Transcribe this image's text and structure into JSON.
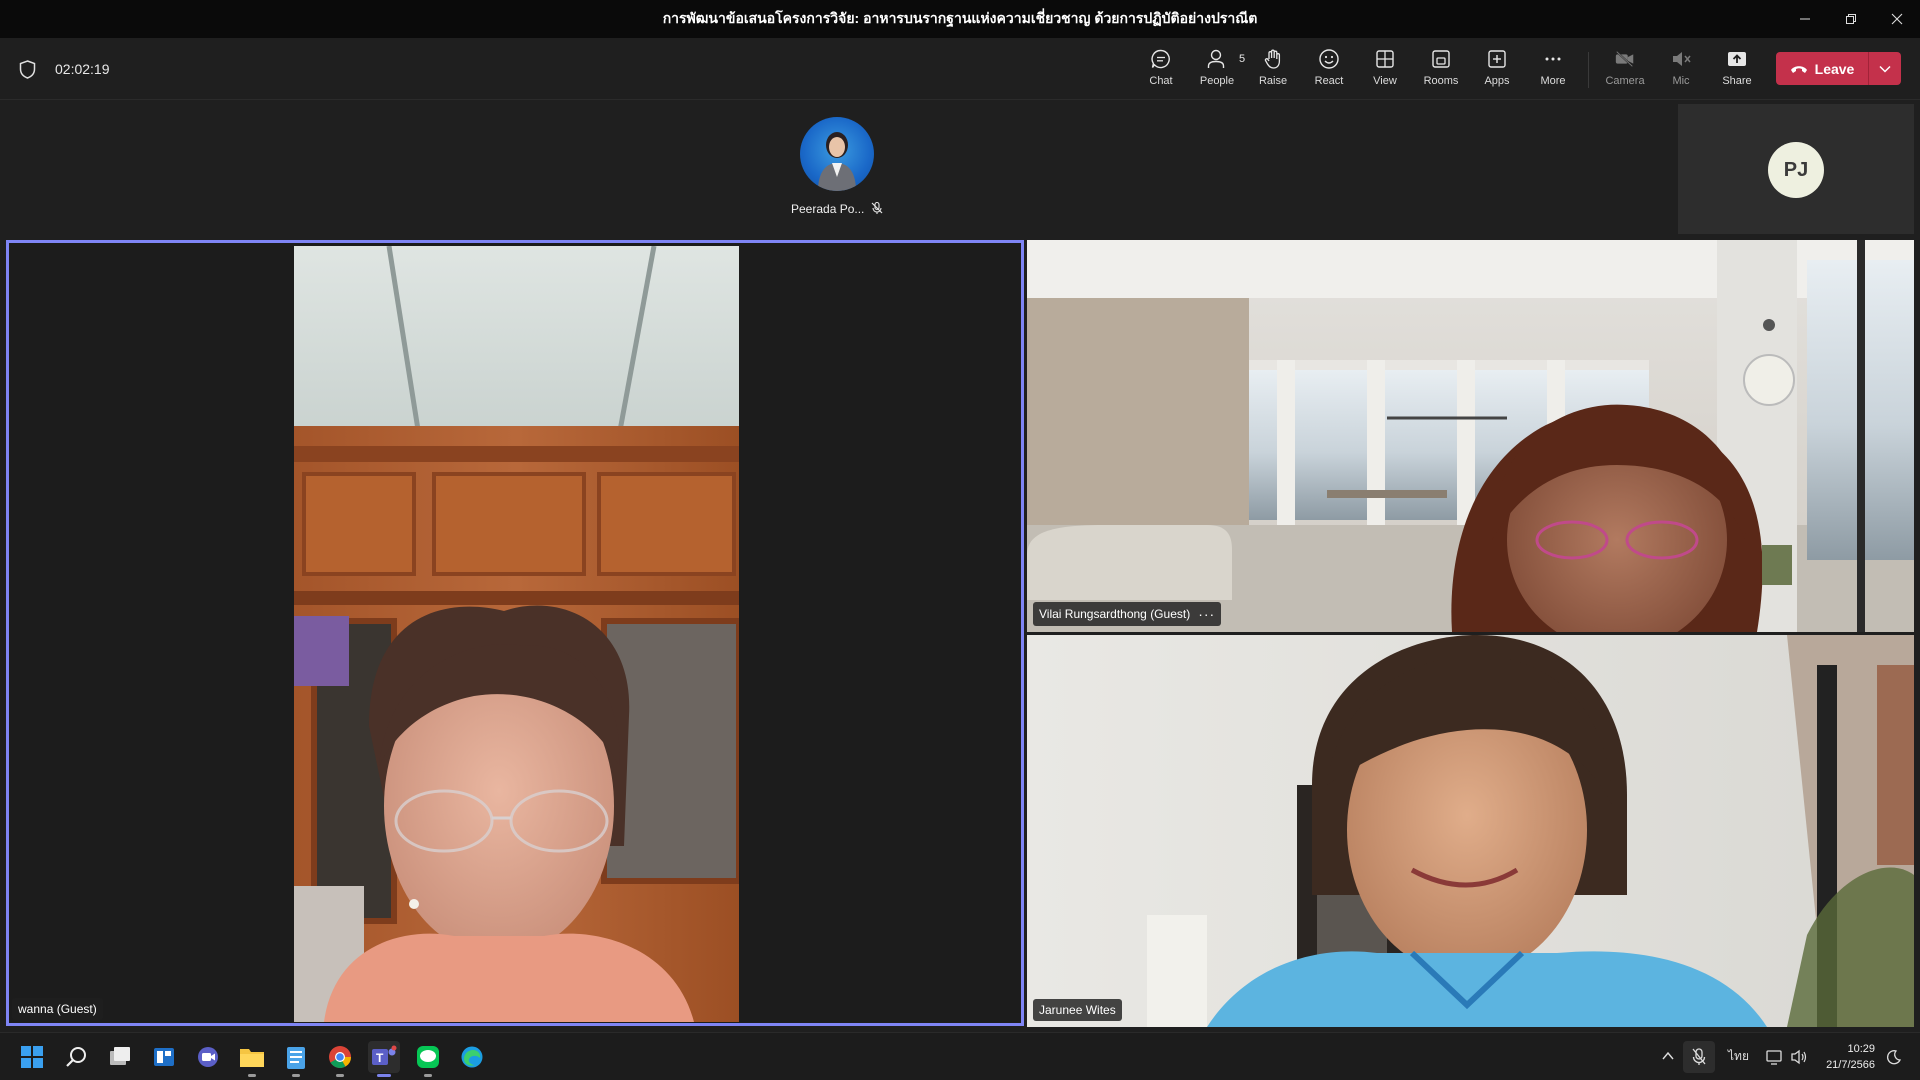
{
  "window": {
    "title": "การพัฒนาข้อเสนอโครงการวิจัย: อาหารบนรากฐานแห่งความเชี่ยวชาญ ด้วยการปฏิบัติอย่างปราณีต"
  },
  "toolbar": {
    "timer": "02:02:19",
    "chat_label": "Chat",
    "people_label": "People",
    "people_count": "5",
    "raise_label": "Raise",
    "react_label": "React",
    "view_label": "View",
    "rooms_label": "Rooms",
    "apps_label": "Apps",
    "more_label": "More",
    "camera_label": "Camera",
    "mic_label": "Mic",
    "share_label": "Share",
    "leave_label": "Leave"
  },
  "participants": {
    "top_strip": [
      {
        "name": "Peerada Po..."
      },
      {
        "initials": "PJ"
      }
    ],
    "tiles": [
      {
        "name": "wanna (Guest)"
      },
      {
        "name": "Vilai Rungsardthong (Guest)"
      },
      {
        "name": "Jarunee Wites"
      }
    ]
  },
  "taskbar": {
    "language": "ไทย",
    "time": "10:29",
    "date": "21/7/2566"
  },
  "colors": {
    "leave": "#c4314b",
    "active_speaker_border": "#7f85f5",
    "toolbar_bg": "#1f1f1f",
    "titlebar_bg": "#0a0a0a"
  }
}
